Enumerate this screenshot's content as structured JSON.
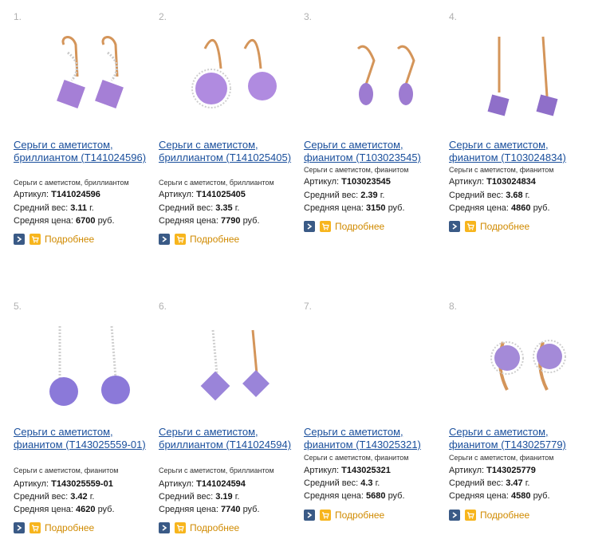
{
  "labels": {
    "article": "Артикул:",
    "weight": "Средний вес:",
    "price": "Средняя цена:",
    "more": "Подробнее",
    "weight_unit": "г.",
    "price_unit": "руб."
  },
  "products": [
    {
      "num": "1.",
      "title": "Серьги с аметистом, бриллиантом (Т141024596)",
      "desc": "Серьги с аметистом, бриллиантом",
      "article": "Т141024596",
      "weight": "3.11",
      "price": "6700"
    },
    {
      "num": "2.",
      "title": "Серьги с аметистом, бриллиантом (Т141025405)",
      "desc": "Серьги с аметистом, бриллиантом",
      "article": "Т141025405",
      "weight": "3.35",
      "price": "7790"
    },
    {
      "num": "3.",
      "title": "Серьги с аметистом, фианитом (Т103023545)",
      "desc": "Серьги с аметистом, фианитом",
      "article": "Т103023545",
      "weight": "2.39",
      "price": "3150"
    },
    {
      "num": "4.",
      "title": "Серьги с аметистом, фианитом (Т103024834)",
      "desc": "Серьги с аметистом, фианитом",
      "article": "Т103024834",
      "weight": "3.68",
      "price": "4860"
    },
    {
      "num": "5.",
      "title": "Серьги с аметистом, фианитом (Т143025559-01)",
      "desc": "Серьги с аметистом, фианитом",
      "article": "Т143025559-01",
      "weight": "3.42",
      "price": "4620"
    },
    {
      "num": "6.",
      "title": "Серьги с аметистом, бриллиантом (Т141024594)",
      "desc": "Серьги с аметистом, бриллиантом",
      "article": "Т141024594",
      "weight": "3.19",
      "price": "7740"
    },
    {
      "num": "7.",
      "title": "Серьги с аметистом, фианитом (Т143025321)",
      "desc": "Серьги с аметистом, фианитом",
      "article": "Т143025321",
      "weight": "4.3",
      "price": "5680"
    },
    {
      "num": "8.",
      "title": "Серьги с аметистом, фианитом (Т143025779)",
      "desc": "Серьги с аметистом, фианитом",
      "article": "Т143025779",
      "weight": "3.47",
      "price": "4580"
    }
  ]
}
